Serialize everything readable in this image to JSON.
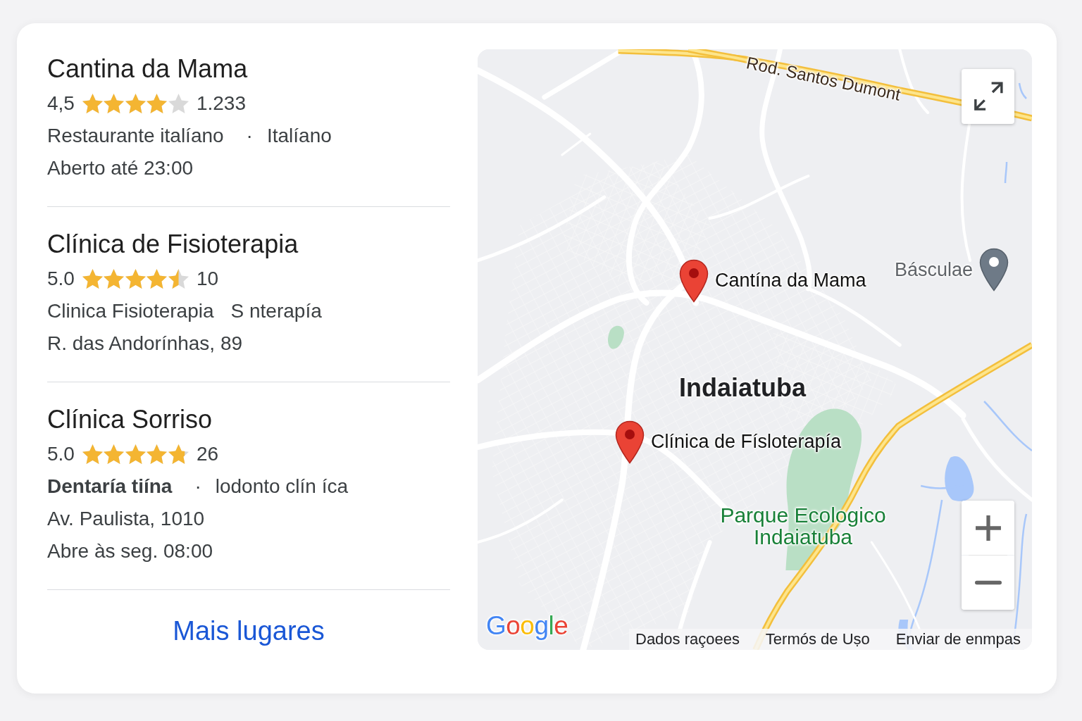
{
  "places": [
    {
      "name": "Cantina da Mama",
      "rating": "4,5",
      "stars": 4,
      "review_count": "1.233",
      "category": [
        {
          "kind": "label",
          "text": "Restaurante italíano",
          "bold": false
        },
        {
          "kind": "separator",
          "text": "·",
          "bold": false
        },
        {
          "kind": "label",
          "text": "Italíano",
          "bold": false
        }
      ],
      "details": [
        "Aberto até 23:00"
      ]
    },
    {
      "name": "Clínica de Fisioterapia",
      "rating": "5.0",
      "stars": 4.5,
      "review_count": "10",
      "category": [
        {
          "kind": "label",
          "text": "Clinica Fisioterapia",
          "bold": false
        },
        {
          "kind": "label",
          "text": "S nterapía",
          "bold": false
        }
      ],
      "details": [
        "R. das Andorínhas, 89"
      ]
    },
    {
      "name": "Clínica Sorriso",
      "rating": "5.0",
      "stars": 4.8,
      "review_count": "26",
      "category": [
        {
          "kind": "label",
          "text": "Dentaría tiína",
          "bold": true
        },
        {
          "kind": "separator",
          "text": "·",
          "bold": false
        },
        {
          "kind": "label",
          "text": "lodonto clín íca",
          "bold": false
        }
      ],
      "details": [
        "Av. Paulista, 1010",
        "Abre às seg. 08:00"
      ]
    }
  ],
  "more_link": "Mais lugares",
  "map": {
    "labels": [
      {
        "kind": "road",
        "text": "Rod. Santos Dumont"
      },
      {
        "kind": "city",
        "text": "Indaiatuba"
      },
      {
        "kind": "park",
        "text": "Parque Ecologico Indaiatuba"
      }
    ],
    "markers": [
      {
        "kind": "place",
        "label": "Cantína da Mama"
      },
      {
        "kind": "place",
        "label": "Clínica de Físloterapía"
      },
      {
        "kind": "landmark",
        "label": "Básculae"
      }
    ],
    "logo": "Google",
    "footer_links": [
      "Dados raçoees",
      "Termós de Uṣo",
      "Enviar de enmpas"
    ]
  }
}
